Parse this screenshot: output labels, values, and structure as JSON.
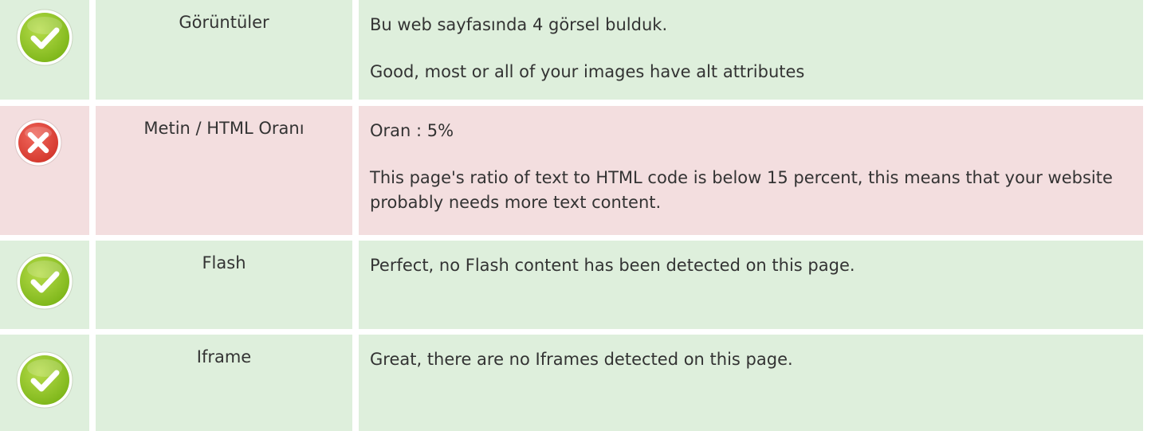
{
  "colors": {
    "pass_bg": "#deefdc",
    "fail_bg": "#f3dedf",
    "pass_icon": "#8dc21f",
    "fail_icon": "#e0453b"
  },
  "rows": [
    {
      "status": "pass",
      "icon": "check-icon",
      "label": "Görüntüler",
      "lines": [
        "Bu web sayfasında 4 görsel bulduk.",
        "Good, most or all of your images have alt attributes"
      ]
    },
    {
      "status": "fail",
      "icon": "cross-icon",
      "label": "Metin / HTML Oranı",
      "lines": [
        "Oran : 5%",
        "This page's ratio of text to HTML code is below 15 percent, this means that your website probably needs more text content."
      ]
    },
    {
      "status": "pass",
      "icon": "check-icon",
      "label": "Flash",
      "lines": [
        "Perfect, no Flash content has been detected on this page."
      ]
    },
    {
      "status": "pass",
      "icon": "check-icon",
      "label": "Iframe",
      "lines": [
        "Great, there are no Iframes detected on this page."
      ]
    }
  ]
}
